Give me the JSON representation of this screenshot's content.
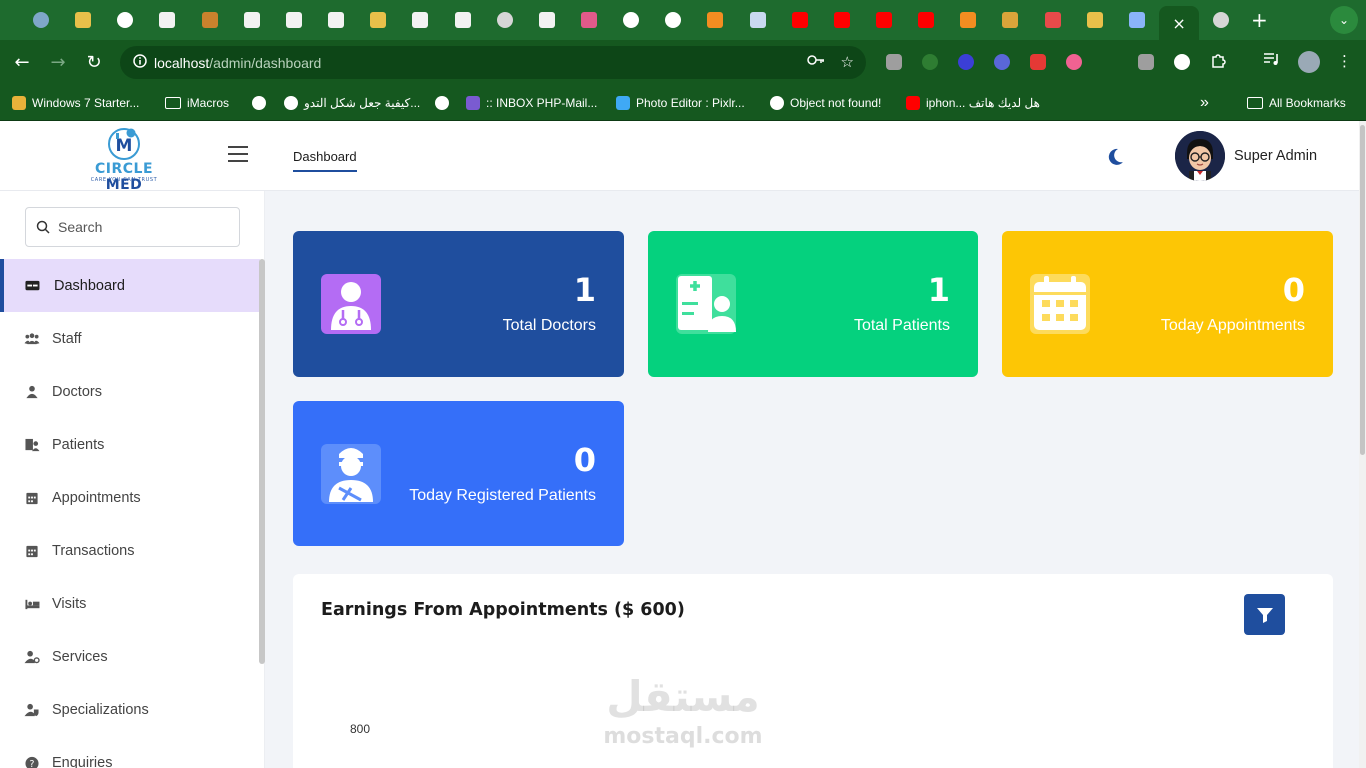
{
  "browser": {
    "tab_favicons": [
      {
        "icon": "globe-icon",
        "color": "#7fa7c9"
      },
      {
        "icon": "heart-hands-icon",
        "color": "#e8c04a"
      },
      {
        "icon": "spiral-icon",
        "color": "#ffffff"
      },
      {
        "icon": "bird-icon",
        "color": "#f2f2f2"
      },
      {
        "icon": "book-icon",
        "color": "#c9822d"
      },
      {
        "icon": "bird-icon",
        "color": "#f2f2f2"
      },
      {
        "icon": "bird-icon",
        "color": "#f2f2f2"
      },
      {
        "icon": "bird-icon",
        "color": "#f2f2f2"
      },
      {
        "icon": "heart-hands-icon",
        "color": "#e8c04a"
      },
      {
        "icon": "bird-icon",
        "color": "#f2f2f2"
      },
      {
        "icon": "bird-icon",
        "color": "#f2f2f2"
      },
      {
        "icon": "globe-icon",
        "color": "#d6d6d6"
      },
      {
        "icon": "bird-icon",
        "color": "#f2f2f2"
      },
      {
        "icon": "runner-icon",
        "color": "#e05a8a"
      },
      {
        "icon": "google-icon",
        "color": "#ffffff"
      },
      {
        "icon": "google-icon",
        "color": "#ffffff"
      },
      {
        "icon": "xampp-icon",
        "color": "#f28d21"
      },
      {
        "icon": "php-icon",
        "color": "#c8d9f0"
      },
      {
        "icon": "youtube-icon",
        "color": "#ff0000"
      },
      {
        "icon": "youtube-icon",
        "color": "#ff0000"
      },
      {
        "icon": "youtube-icon",
        "color": "#ff0000"
      },
      {
        "icon": "youtube-icon",
        "color": "#ff0000"
      },
      {
        "icon": "xampp-icon",
        "color": "#f28d21"
      },
      {
        "icon": "tent-icon",
        "color": "#d9a43a"
      },
      {
        "icon": "no-entry-icon",
        "color": "#e84a4a"
      },
      {
        "icon": "heart-hands-icon",
        "color": "#e8c04a"
      },
      {
        "icon": "window-icon",
        "color": "#8ab4f8"
      },
      {
        "icon": "close-icon",
        "color": "#ffffff"
      },
      {
        "icon": "globe-icon",
        "color": "#d6d6d6"
      }
    ],
    "new_tab_label": "+",
    "close_tab_label": "×",
    "url_host": "localhost",
    "url_path": "/admin/dashboard",
    "bookmarks": [
      {
        "label": "Windows 7 Starter...",
        "icon": "windows-icon",
        "color": "#e8b23a"
      },
      {
        "label": "iMacros",
        "icon": "folder-icon",
        "color": "#ffffff"
      },
      {
        "label": "",
        "icon": "globe-icon",
        "color": "#ffffff"
      },
      {
        "label": "كيفية جعل شكل التدو...",
        "icon": "globe-icon",
        "color": "#ffffff"
      },
      {
        "label": "",
        "icon": "globe-icon",
        "color": "#ffffff"
      },
      {
        "label": ":: INBOX PHP-Mail...",
        "icon": "feather-icon",
        "color": "#7a5bd1"
      },
      {
        "label": "Photo Editor : Pixlr...",
        "icon": "pixlr-icon",
        "color": "#3fa9f5"
      },
      {
        "label": "Object not found!",
        "icon": "globe-icon",
        "color": "#ffffff"
      },
      {
        "label": "iphon... هل لديك هاتف",
        "icon": "youtube-icon",
        "color": "#ff0000"
      }
    ],
    "more_bookmarks": "»",
    "all_bookmarks": "All Bookmarks"
  },
  "app": {
    "logo": {
      "circle": "CIRCLE",
      "med": " MED",
      "tagline": "CARE YOU CAN TRUST"
    },
    "header_tab": "Dashboard",
    "user_name": "Super Admin",
    "search_placeholder": "Search",
    "nav": [
      {
        "label": "Dashboard",
        "icon": "dashboard-icon",
        "active": true
      },
      {
        "label": "Staff",
        "icon": "users-icon"
      },
      {
        "label": "Doctors",
        "icon": "doctor-icon"
      },
      {
        "label": "Patients",
        "icon": "patient-icon"
      },
      {
        "label": "Appointments",
        "icon": "calendar-icon"
      },
      {
        "label": "Transactions",
        "icon": "calendar-icon"
      },
      {
        "label": "Visits",
        "icon": "bed-icon"
      },
      {
        "label": "Services",
        "icon": "user-gear-icon"
      },
      {
        "label": "Specializations",
        "icon": "user-shield-icon"
      },
      {
        "label": "Enquiries",
        "icon": "question-icon"
      }
    ],
    "stats": [
      {
        "count": "1",
        "label": "Total Doctors",
        "icon": "doctor-icon",
        "color": "#1f4e9e",
        "icon_bg": "#b46cf4"
      },
      {
        "count": "1",
        "label": "Total Patients",
        "icon": "patient-card-icon",
        "color": "#05d17e",
        "icon_bg": "#3fdf9c"
      },
      {
        "count": "0",
        "label": "Today Appointments",
        "icon": "calendar-icon",
        "color": "#fdc605",
        "icon_bg": "#fddb5c"
      },
      {
        "count": "0",
        "label": "Today Registered Patients",
        "icon": "injured-patient-icon",
        "color": "#356ff9",
        "icon_bg": "#5d8efb"
      }
    ],
    "earnings": {
      "title": "Earnings From Appointments ($ 600)",
      "y_tick_top": "800"
    },
    "watermark": {
      "arabic": "مستقل",
      "latin": "mostaql.com"
    }
  }
}
